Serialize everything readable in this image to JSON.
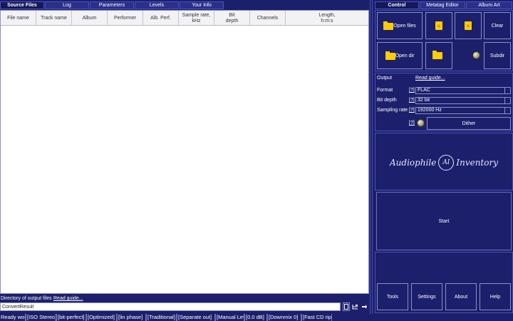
{
  "left_tabs": [
    "Source Files",
    "Log",
    "Parameters",
    "Levels",
    "Your Info"
  ],
  "table": {
    "columns": [
      "File name",
      "Track name",
      "Album",
      "Performer",
      "Alb. Perf.",
      "Sample rate,\nkHz",
      "Bit\ndepth",
      "Channels",
      "Length,\nh:m:s"
    ]
  },
  "output": {
    "label": "Directory of output files",
    "guide": "Read guide...",
    "value": "ConvertResult"
  },
  "right_tabs": [
    "Control",
    "Metatag Editor",
    "Album Art"
  ],
  "control": {
    "open_files": "Open files",
    "clear": "Clear",
    "open_dir": "Open dir",
    "subdir": "Subdir",
    "add_symbol": "+",
    "remove_symbol": "×"
  },
  "options": {
    "output_label": "Output",
    "guide": "Read guide...",
    "format_label": "Format",
    "format_value": "FLAC",
    "bitdepth_label": "Bit depth",
    "bitdepth_value": "32 bit",
    "sampling_label": "Sampling rate",
    "sampling_value": "192000 Hz",
    "help": "[?]",
    "dither": "Dither"
  },
  "logo": {
    "left": "Audiophile",
    "mark": "AI",
    "right": "Inventory"
  },
  "start": "Start",
  "bottom_buttons": [
    "Tools",
    "Settings",
    "About",
    "Help"
  ],
  "status": [
    "Ready work",
    "[ISO Stereo]",
    "[bit-perfect]",
    "[Optimized]",
    "[lin phase]",
    "[Traditional]",
    "[Separate out]",
    "[Manual Lev]",
    "[0.0 dB]",
    "[Downmix 0]",
    "[Fast CD rip]"
  ],
  "colors": {
    "background": "#1c1f6b",
    "border": "#4a52b8",
    "folder": "#ffcc00"
  }
}
